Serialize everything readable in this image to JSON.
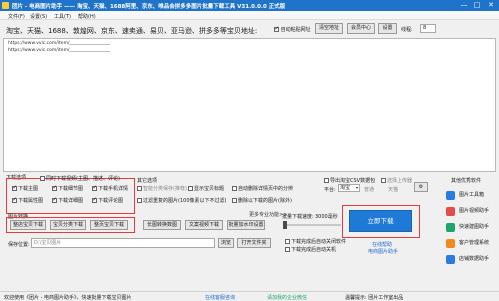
{
  "title": "团片 - 电商图片助手 —— 淘宝、天猫、1688阿里、京东、唯品会拼多多图片批量下载工具 V31.0.0.0 正式版",
  "window": {
    "min": "—",
    "max": "□",
    "close": "✕"
  },
  "menu": [
    "文件(F)",
    "设置(S)",
    "工具(T)",
    "帮助(H)"
  ],
  "url_hint": "淘宝、天猫、1688、敦煌网、京东、速卖通、易贝、亚马逊、拼多多等宝贝地址:",
  "auto_paste_label": "自动粘贴网址",
  "top_buttons": {
    "clear": "清空地址",
    "member": "会员中心",
    "settings": "设置"
  },
  "threads_label": "线程:",
  "threads_value": "8",
  "urls": [
    "https://www.vvic.com/item/__________________",
    "https://www.vvic.com/item/__________________"
  ],
  "download_options": {
    "title": "下载选项",
    "sync_label": "同时下载视频(主图、描述、评论)",
    "items": [
      {
        "label": "下载主图",
        "checked": true
      },
      {
        "label": "下载细节图",
        "checked": true
      },
      {
        "label": "下载手机详情",
        "checked": true
      },
      {
        "label": "下载属性图",
        "checked": true
      },
      {
        "label": "下载详细图",
        "checked": true
      },
      {
        "label": "下载评论图",
        "checked": true
      }
    ]
  },
  "more_options": {
    "title": "其它选项",
    "items": [
      {
        "label": "智能分类保存(推荐)",
        "checked": false
      },
      {
        "label": "显示宝贝标题",
        "checked": false
      },
      {
        "label": "自动删除详情页中的分辨",
        "checked": false
      },
      {
        "label": "过滤重复的图片(100像素以下不过滤)",
        "checked": false
      },
      {
        "label": "删除以下载的图片(除外)",
        "checked": false
      }
    ]
  },
  "right_options": {
    "items": [
      {
        "label": "导出淘宝CSV数据包",
        "checked": false
      },
      {
        "label": "选择上传器",
        "checked": false
      }
    ],
    "platform_label": "平台:",
    "platform_value": "淘宝",
    "radio_1": "普通",
    "radio_2": "天猫"
  },
  "convert_label": "图片转换",
  "buttons": {
    "bulk": "整店宝贝下载",
    "category": "宝贝分类下载",
    "whole": "整页宝贝下载",
    "multi": "长图转换数图",
    "video": "文案视频下载",
    "download_rule": "批量加水印设置"
  },
  "more_tools": "更多专业功能>>",
  "save_label": "保存位置:",
  "save_placeholder": "D:\\宝贝图片",
  "browse": "浏览",
  "open_folder": "打开文件夹",
  "speed_label": "批量下载速度:",
  "speed_value": "3000毫秒",
  "after_label_1": "下载完成后自动关闭软件",
  "after_label_2": "下载完成后自动关机",
  "download_now": "立即下载",
  "link_1": "在线帮助",
  "link_2": "电商图片助手",
  "side_title": "其他优秀软件",
  "side_items": [
    "图片工具箱",
    "图片视频助手",
    "快速建图助手",
    "客户管理系统",
    "店铺数据助手"
  ],
  "status": {
    "left": "欢迎使用《团片 - 电商图片助手》，快速批量下载宝贝图片",
    "mid": "在线客服咨询",
    "right1": "请加我的企业微信",
    "right2": "温馨提示: 团片工作室出品"
  },
  "colors": {
    "title_bar": "#1f74c9",
    "highlight": "#e53b3b",
    "accent": "#1e7ad6"
  }
}
